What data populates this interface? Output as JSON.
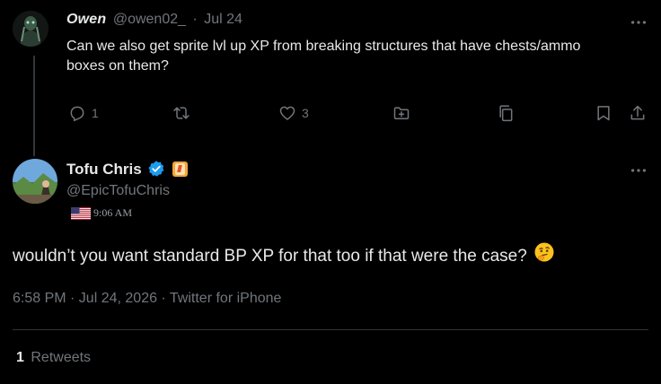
{
  "reply": {
    "display_name": "Owen",
    "handle": "@owen02_",
    "separator": "·",
    "date": "Jul 24",
    "text": "Can we also get sprite lvl up XP from breaking structures that have chests/ammo boxes on them?",
    "reply_count": "1",
    "like_count": "3"
  },
  "main": {
    "display_name": "Tofu Chris",
    "handle": "@EpicTofuChris",
    "local_time": "9:06 AM",
    "text": "wouldn’t you want standard BP XP for that too if that were the case?",
    "emoji": "🤔",
    "timestamp": "6:58 PM · Jul 24, 2026 · Twitter for iPhone",
    "retweet_count": "1",
    "retweet_label": "Retweets"
  },
  "colors": {
    "background": "#000000",
    "text": "#e7e9ea",
    "muted": "#71767b",
    "verified": "#1d9bf0",
    "divider": "#2f3336"
  },
  "icons": {
    "more": "more-icon",
    "reply": "reply-icon",
    "retweet": "retweet-icon",
    "like": "heart-icon",
    "bookmark_folder": "add-folder-icon",
    "copy": "copy-icon",
    "bookmark": "bookmark-icon",
    "share": "share-icon",
    "verified": "verified-badge-icon",
    "flag": "us-flag-icon"
  }
}
